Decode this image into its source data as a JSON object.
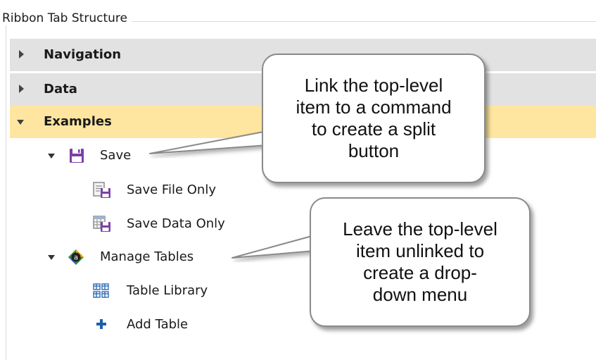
{
  "group_title": "Ribbon Tab Structure",
  "tree": {
    "categories": [
      {
        "label": "Navigation",
        "expanded": false,
        "selected": false
      },
      {
        "label": "Data",
        "expanded": false,
        "selected": false
      },
      {
        "label": "Examples",
        "expanded": true,
        "selected": true
      }
    ],
    "items": [
      {
        "label": "Save",
        "icon": "save-icon",
        "expanded": true,
        "children": [
          {
            "label": "Save File Only",
            "icon": "save-file-icon"
          },
          {
            "label": "Save Data Only",
            "icon": "save-data-icon"
          }
        ]
      },
      {
        "label": "Manage Tables",
        "icon": "manage-tables-icon",
        "expanded": true,
        "children": [
          {
            "label": "Table Library",
            "icon": "table-library-icon"
          },
          {
            "label": "Add Table",
            "icon": "plus-icon"
          }
        ]
      }
    ]
  },
  "callouts": [
    {
      "text": "Link the top-level\nitem to a command\nto create a split\nbutton"
    },
    {
      "text": "Leave the top-level\nitem unlinked to\ncreate a drop-\ndown menu"
    }
  ],
  "colors": {
    "selected_row": "#ffe6a0",
    "category_row": "#e2e2e2",
    "save_icon": "#7b3fa8",
    "add_icon": "#1f5faa"
  }
}
